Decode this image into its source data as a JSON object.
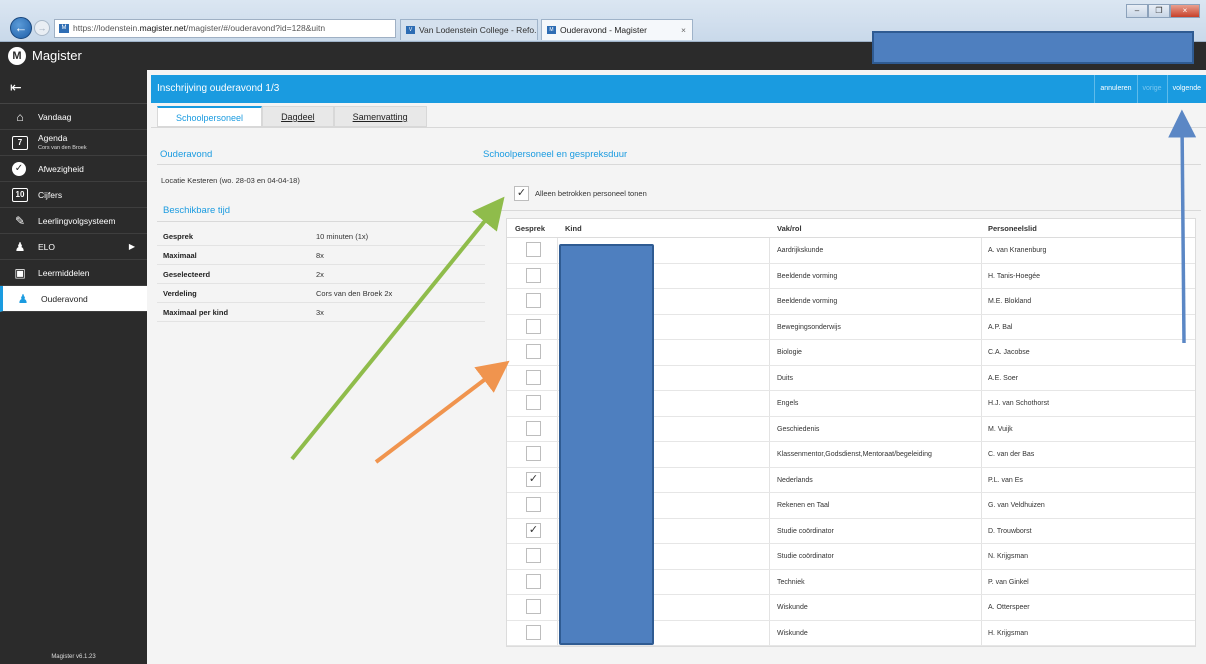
{
  "browser": {
    "url": "https://lodenstein.magister.net/magister/#/ouderavond?id=128&uitn",
    "url_prefix": "https://lodenstein.",
    "url_domain": "magister.net",
    "url_rest": "/magister/#/ouderavond?id=128&uitn",
    "tabs": [
      {
        "label": "Van Lodenstein College - Refo..."
      },
      {
        "label": "Ouderavond - Magister"
      }
    ]
  },
  "app": {
    "title": "Magister"
  },
  "sidebar": {
    "items": [
      {
        "label": "Vandaag",
        "icon": "home-icon"
      },
      {
        "label": "Agenda",
        "sub": "Cors van den Broek",
        "icon": "calendar-icon",
        "icon_text": "7"
      },
      {
        "label": "Afwezigheid",
        "icon": "check-circle-icon"
      },
      {
        "label": "Cijfers",
        "icon": "grade-icon",
        "icon_text": "10"
      },
      {
        "label": "Leerlingvolgsysteem",
        "icon": "pencil-icon"
      },
      {
        "label": "ELO",
        "icon": "group-icon"
      },
      {
        "label": "Leermiddelen",
        "icon": "books-icon"
      },
      {
        "label": "Ouderavond",
        "icon": "people-icon"
      }
    ],
    "version": "Magister v6.1.23"
  },
  "page": {
    "title": "Inschrijving ouderavond 1/3",
    "actions": {
      "cancel": "annuleren",
      "prev": "vorige",
      "next": "volgende"
    },
    "tabs": [
      "Schoolpersoneel",
      "Dagdeel",
      "Samenvatting"
    ]
  },
  "left": {
    "heading": "Ouderavond",
    "location": "Locatie Kesteren (wo. 28-03 en 04-04-18)",
    "time_heading": "Beschikbare tijd",
    "rows": [
      {
        "key": "Gesprek",
        "value": "10 minuten (1x)"
      },
      {
        "key": "Maximaal",
        "value": "8x"
      },
      {
        "key": "Geselecteerd",
        "value": "2x"
      },
      {
        "key": "Verdeling",
        "value": "Cors van den Broek 2x"
      },
      {
        "key": "Maximaal per kind",
        "value": "3x"
      }
    ]
  },
  "right": {
    "heading": "Schoolpersoneel en gespreksduur",
    "filter_label": "Alleen betrokken personeel tonen",
    "filter_checked": true,
    "columns": [
      "Gesprek",
      "Kind",
      "Vak/rol",
      "Personeelslid"
    ],
    "rows": [
      {
        "checked": false,
        "subject": "Aardrijkskunde",
        "staff": "A. van Kranenburg"
      },
      {
        "checked": false,
        "subject": "Beeldende vorming",
        "staff": "H. Tanis-Hoegée"
      },
      {
        "checked": false,
        "subject": "Beeldende vorming",
        "staff": "M.E. Blokland"
      },
      {
        "checked": false,
        "subject": "Bewegingsonderwijs",
        "staff": "A.P. Bal"
      },
      {
        "checked": false,
        "subject": "Biologie",
        "staff": "C.A. Jacobse"
      },
      {
        "checked": false,
        "subject": "Duits",
        "staff": "A.E. Soer"
      },
      {
        "checked": false,
        "subject": "Engels",
        "staff": "H.J. van Schothorst"
      },
      {
        "checked": false,
        "subject": "Geschiedenis",
        "staff": "M. Vuijk"
      },
      {
        "checked": false,
        "subject": "Klassenmentor,Godsdienst,Mentoraat/begeleiding",
        "staff": "C. van der Bas"
      },
      {
        "checked": true,
        "subject": "Nederlands",
        "staff": "P.L. van Es"
      },
      {
        "checked": false,
        "subject": "Rekenen en Taal",
        "staff": "G. van Veldhuizen"
      },
      {
        "checked": true,
        "subject": "Studie coördinator",
        "staff": "D. Trouwborst"
      },
      {
        "checked": false,
        "subject": "Studie coördinator",
        "staff": "N. Krijgsman"
      },
      {
        "checked": false,
        "subject": "Techniek",
        "staff": "P. van Ginkel"
      },
      {
        "checked": false,
        "subject": "Wiskunde",
        "staff": "A. Otterspeer"
      },
      {
        "checked": false,
        "subject": "Wiskunde",
        "staff": "H. Krijgsman"
      }
    ]
  },
  "colors": {
    "accent": "#1a9be0",
    "sidebar": "#2b2b2b",
    "redaction": "#4e7fbf",
    "arrow_green": "#8fbc4b",
    "arrow_orange": "#f0944e",
    "arrow_blue": "#5b87c5"
  }
}
